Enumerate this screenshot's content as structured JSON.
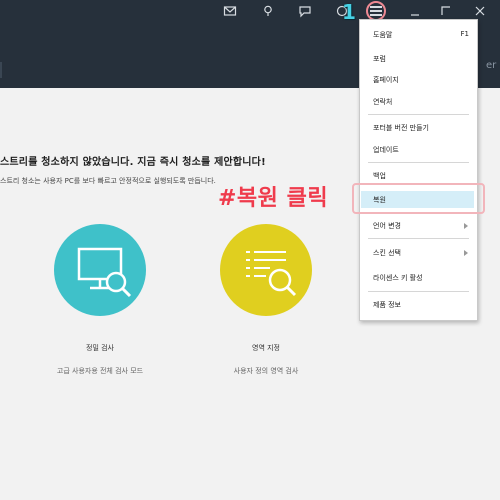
{
  "titlebar": {
    "icons": [
      "mail-icon",
      "bulb-icon",
      "chat-icon",
      "globe-icon",
      "menu-icon",
      "minimize-icon",
      "maximize-icon",
      "close-icon"
    ],
    "header_cut_text": "er",
    "step_number": "1"
  },
  "main": {
    "headline": "스트리를 청소하지 않았습니다. 지금 즉시 청소를 제안합니다!",
    "subline": "스트리 청소는 사용자 PC를 보다 빠르고 안정적으로 실행되도록 만듭니다.",
    "options": [
      {
        "title": "정밀 검사",
        "desc": "고급 사용자용 전체 검사 모드",
        "color": "#3fc1c9",
        "icon": "monitor-search-icon"
      },
      {
        "title": "영역 지정",
        "desc": "사용자 정의 영역 검사",
        "color": "#e0cf1f",
        "icon": "list-search-icon"
      }
    ]
  },
  "menu": {
    "items": [
      {
        "label": "도움말",
        "shortcut": "F1"
      },
      {
        "label": "포럼"
      },
      {
        "label": "홈페이지"
      },
      {
        "label": "연락처"
      },
      {
        "label": "포터블 버전 만들기"
      },
      {
        "label": "업데이트"
      },
      {
        "label": "백업"
      },
      {
        "label": "복원"
      },
      {
        "label": "언어 변경"
      },
      {
        "label": "스킨 선택"
      },
      {
        "label": "라이센스 키 활성"
      },
      {
        "label": "제품 정보"
      }
    ]
  },
  "annotation": {
    "text": "#복원 클릭",
    "color": "#ef3b4c"
  }
}
